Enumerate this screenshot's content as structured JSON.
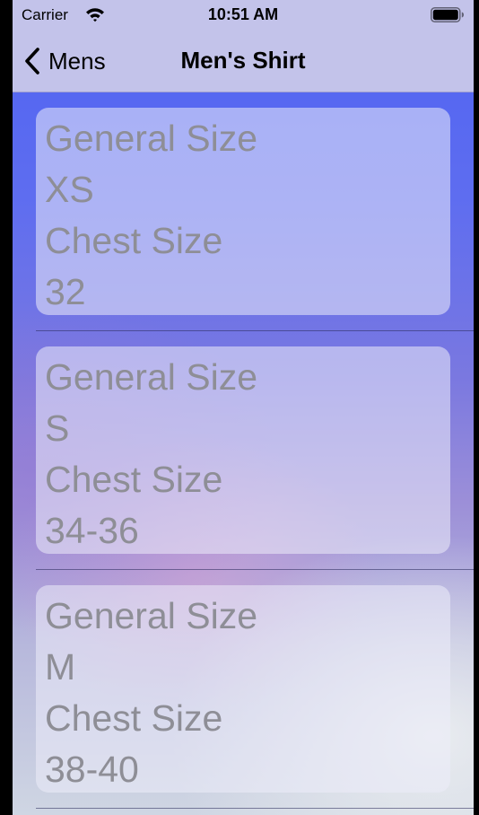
{
  "status_bar": {
    "carrier": "Carrier",
    "time": "10:51 AM"
  },
  "nav": {
    "back_label": "Mens",
    "title": "Men's Shirt"
  },
  "sizes": [
    {
      "general_label": "General Size",
      "general_value": "XS",
      "chest_label": "Chest Size",
      "chest_value": "32"
    },
    {
      "general_label": "General Size",
      "general_value": "S",
      "chest_label": "Chest Size",
      "chest_value": "34-36"
    },
    {
      "general_label": "General Size",
      "general_value": "M",
      "chest_label": "Chest Size",
      "chest_value": "38-40"
    }
  ]
}
